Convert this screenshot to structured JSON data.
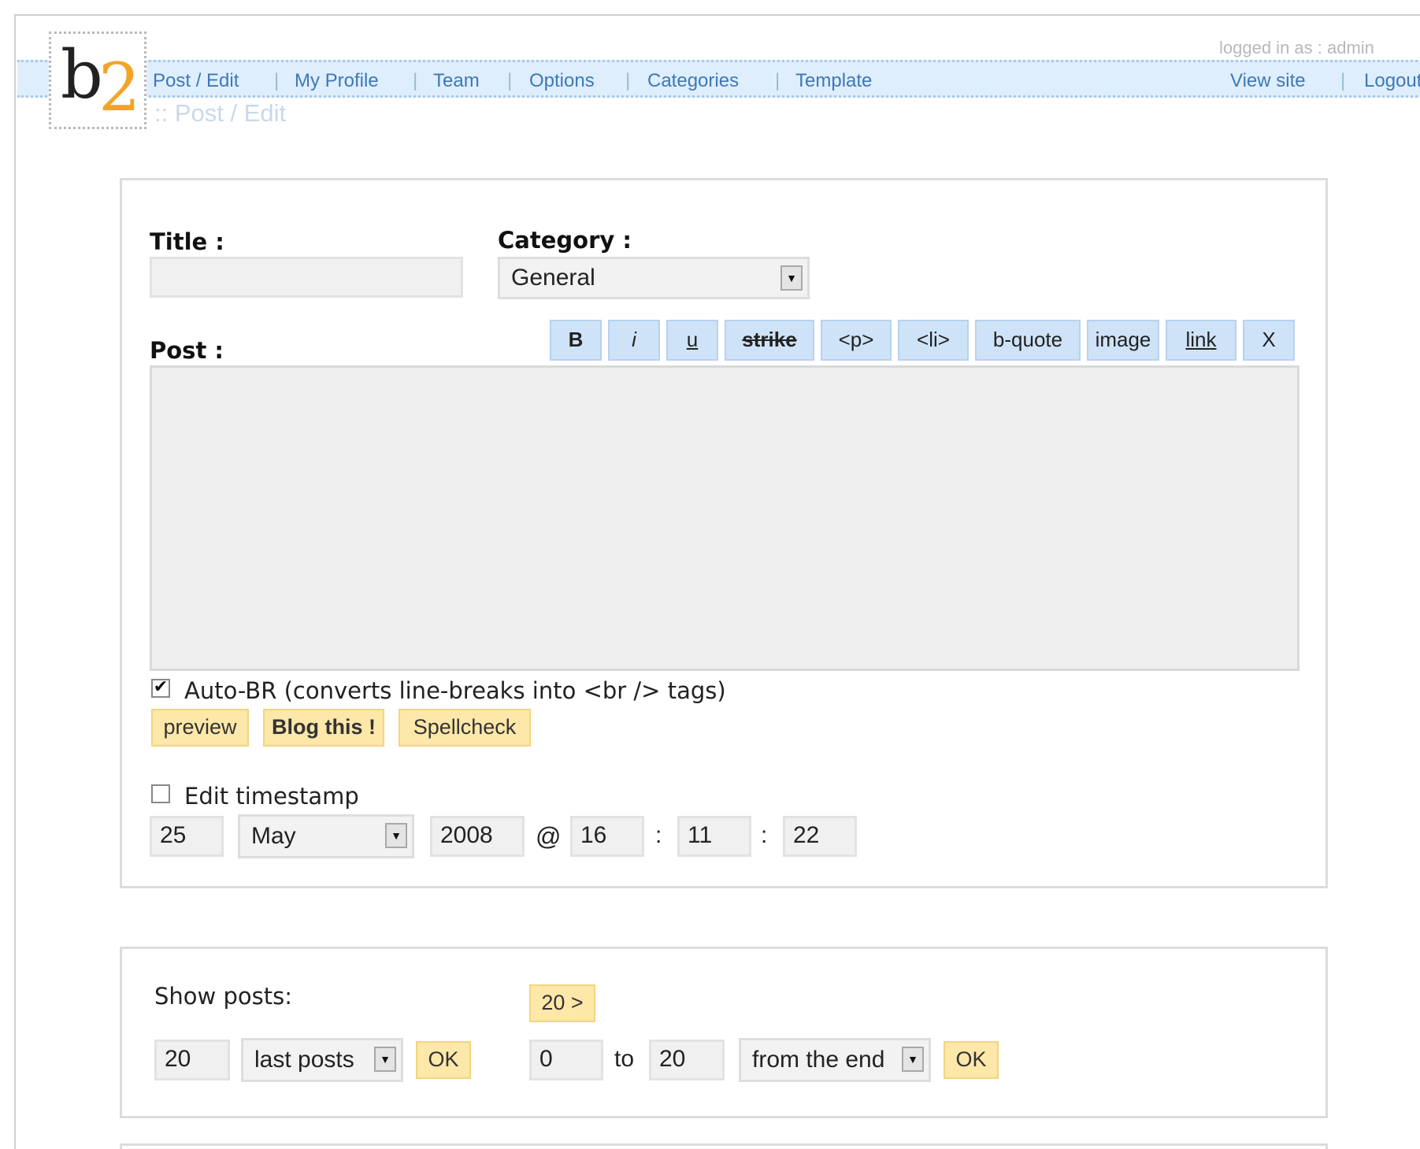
{
  "header": {
    "logo": {
      "b": "b",
      "two": "2"
    },
    "logged_in": "logged in as : admin",
    "nav_left": [
      "Post / Edit",
      "My Profile",
      "Team",
      "Options",
      "Categories",
      "Template"
    ],
    "nav_right": [
      "View site",
      "Logout"
    ],
    "separator": "|",
    "page_title": ":: Post / Edit"
  },
  "form": {
    "title_label": "Title :",
    "title_value": "",
    "category_label": "Category :",
    "category_selected": "General",
    "post_label": "Post :",
    "quicktags": [
      "B",
      "i",
      "u",
      "strike",
      "<p>",
      "<li>",
      "b-quote",
      "image",
      "link",
      "X"
    ],
    "post_body": "",
    "autobr_checked": true,
    "autobr_label": "Auto-BR (converts line-breaks into <br /> tags)",
    "buttons": {
      "preview": "preview",
      "blog_this": "Blog this !",
      "spellcheck": "Spellcheck"
    },
    "timestamp": {
      "edit_checked": false,
      "label": "Edit timestamp",
      "day": "25",
      "month": "May",
      "year": "2008",
      "at": "@",
      "hour": "16",
      "minute": "11",
      "second": "22",
      "colon": ":"
    }
  },
  "show_posts": {
    "label": "Show posts:",
    "next_button": "20 >",
    "count": "20",
    "mode_selected": "last posts",
    "ok": "OK",
    "from": "0",
    "to_label": "to",
    "to": "20",
    "order_selected": "from the end",
    "ok2": "OK"
  }
}
